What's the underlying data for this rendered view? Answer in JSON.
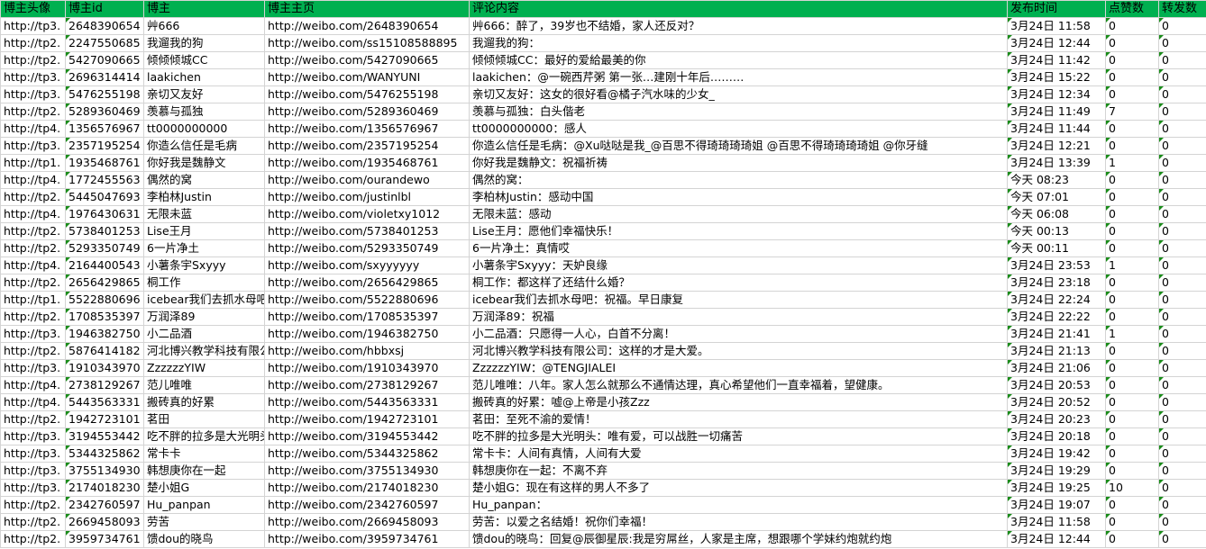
{
  "header": [
    "博主头像",
    "博主id",
    "博主",
    "博主主页",
    "评论内容",
    "发布时间",
    "点赞数",
    "转发数"
  ],
  "colors": {
    "header_bg": "#00b050",
    "grid": "#d4d4d4",
    "flag": "#1a8c1a"
  },
  "rows": [
    [
      "http://tp3.",
      "2648390654",
      "艸666",
      "http://weibo.com/2648390654",
      "艸666：醉了，39岁也不结婚，家人还反对？",
      "3月24日 11:58",
      "0",
      "0"
    ],
    [
      "http://tp2.",
      "2247550685",
      "我遛我的狗",
      "http://weibo.com/ss15108588895",
      "我遛我的狗：",
      "3月24日 12:44",
      "0",
      "0"
    ],
    [
      "http://tp2.",
      "5427090665",
      "倾倾倾城CC",
      "http://weibo.com/5427090665",
      "倾倾倾城CC：最好的爱給最美的你",
      "3月24日 11:42",
      "0",
      "0"
    ],
    [
      "http://tp3.",
      "2696314414",
      "laakichen",
      "http://weibo.com/WANYUNI",
      "laakichen：@一碗西芹粥 第一张…建刚十年后………",
      "3月24日 15:22",
      "0",
      "0"
    ],
    [
      "http://tp3.",
      "5476255198",
      "亲切又友好",
      "http://weibo.com/5476255198",
      "亲切又友好：这女的很好看@橘子汽水味的少女_",
      "3月24日 12:34",
      "0",
      "0"
    ],
    [
      "http://tp2.",
      "5289360469",
      "羡慕与孤独",
      "http://weibo.com/5289360469",
      "羡慕与孤独：白头偕老",
      "3月24日 11:49",
      "7",
      "0"
    ],
    [
      "http://tp4.",
      "1356576967",
      "tt0000000000",
      "http://weibo.com/1356576967",
      "tt0000000000：感人",
      "3月24日 11:44",
      "0",
      "0"
    ],
    [
      "http://tp3.",
      "2357195254",
      "你造么信任是毛病",
      "http://weibo.com/2357195254",
      "你造么信任是毛病：@Xu哒哒是我_@百思不得琦琦琦琦姐 @百思不得琦琦琦琦姐 @你牙缝",
      "3月24日 12:21",
      "0",
      "0"
    ],
    [
      "http://tp1.",
      "1935468761",
      "你好我是魏静文",
      "http://weibo.com/1935468761",
      "你好我是魏静文：祝福祈祷",
      "3月24日 13:39",
      "1",
      "0"
    ],
    [
      "http://tp4.",
      "1772455563",
      "偶然的窝",
      "http://weibo.com/ourandewo",
      "偶然的窝：",
      "今天 08:23",
      "0",
      "0"
    ],
    [
      "http://tp2.",
      "5445047693",
      "李柏林Justin",
      "http://weibo.com/justinlbl",
      "李柏林Justin：感动中国",
      "今天 07:01",
      "0",
      "0"
    ],
    [
      "http://tp4.",
      "1976430631",
      "无限未蓝",
      "http://weibo.com/violetxy1012",
      "无限未蓝：感动",
      "今天 06:08",
      "0",
      "0"
    ],
    [
      "http://tp2.",
      "5738401253",
      "Lise王月",
      "http://weibo.com/5738401253",
      "Lise王月：愿他们幸福快乐！",
      "今天 00:13",
      "0",
      "0"
    ],
    [
      "http://tp2.",
      "5293350749",
      "6一片净土",
      "http://weibo.com/5293350749",
      "6一片净土：真情哎",
      "今天 00:11",
      "0",
      "0"
    ],
    [
      "http://tp4.",
      "2164400543",
      "小薯条宇Sxyyy",
      "http://weibo.com/sxyyyyyy",
      "小薯条宇Sxyyy：天妒良缘",
      "3月24日 23:53",
      "1",
      "0"
    ],
    [
      "http://tp2.",
      "2656429865",
      "桐工作",
      "http://weibo.com/2656429865",
      "桐工作：都这样了还结什么婚？",
      "3月24日 23:18",
      "0",
      "0"
    ],
    [
      "http://tp1.",
      "5522880696",
      "icebear我们去抓水母吧",
      "http://weibo.com/5522880696",
      "icebear我们去抓水母吧：祝福。早日康复",
      "3月24日 22:24",
      "0",
      "0"
    ],
    [
      "http://tp2.",
      "1708535397",
      "万润泽89",
      "http://weibo.com/1708535397",
      "万润泽89：祝福",
      "3月24日 22:22",
      "0",
      "0"
    ],
    [
      "http://tp3.",
      "1946382750",
      "小二品酒",
      "http://weibo.com/1946382750",
      "小二品酒：只愿得一人心，白首不分离！",
      "3月24日 21:41",
      "1",
      "0"
    ],
    [
      "http://tp2.",
      "5876414182",
      "河北博兴教学科技有限公司",
      "http://weibo.com/hbbxsj",
      "河北博兴教学科技有限公司：这样的才是大爱。",
      "3月24日 21:13",
      "0",
      "0"
    ],
    [
      "http://tp3.",
      "1910343970",
      "ZzzzzzYIW",
      "http://weibo.com/1910343970",
      "ZzzzzzYIW：@TENGJIALEI",
      "3月24日 21:06",
      "0",
      "0"
    ],
    [
      "http://tp4.",
      "2738129267",
      "范儿唯唯",
      "http://weibo.com/2738129267",
      "范儿唯唯：八年。家人怎么就那么不通情达理，真心希望他们一直幸福着，望健康。",
      "3月24日 20:53",
      "0",
      "0"
    ],
    [
      "http://tp4.",
      "5443563331",
      "搬砖真的好累",
      "http://weibo.com/5443563331",
      "搬砖真的好累：嘘@上帝是小孩Zzz",
      "3月24日 20:52",
      "0",
      "0"
    ],
    [
      "http://tp2.",
      "1942723101",
      "茗田",
      "http://weibo.com/1942723101",
      "茗田：至死不渝的爱情！",
      "3月24日 20:23",
      "0",
      "0"
    ],
    [
      "http://tp3.",
      "3194553442",
      "吃不胖的拉多是大光明头",
      "http://weibo.com/3194553442",
      "吃不胖的拉多是大光明头：唯有爱，可以战胜一切痛苦",
      "3月24日 20:18",
      "0",
      "0"
    ],
    [
      "http://tp3.",
      "5344325862",
      "常卡卡",
      "http://weibo.com/5344325862",
      "常卡卡：人间有真情，人间有大爱",
      "3月24日 19:42",
      "0",
      "0"
    ],
    [
      "http://tp3.",
      "3755134930",
      "韩想庚你在一起",
      "http://weibo.com/3755134930",
      "韩想庚你在一起：不离不弃",
      "3月24日 19:29",
      "0",
      "0"
    ],
    [
      "http://tp3.",
      "2174018230",
      "楚小姐G",
      "http://weibo.com/2174018230",
      "楚小姐G：现在有这样的男人不多了",
      "3月24日 19:25",
      "10",
      "0"
    ],
    [
      "http://tp2.",
      "2342760597",
      "Hu_panpan",
      "http://weibo.com/2342760597",
      "Hu_panpan：",
      "3月24日 19:07",
      "0",
      "0"
    ],
    [
      "http://tp2.",
      "2669458093",
      "劳苦",
      "http://weibo.com/2669458093",
      "劳苦：以爱之名结婚！祝你们幸福！",
      "3月24日 11:58",
      "0",
      "0"
    ],
    [
      "http://tp2.",
      "3959734761",
      "馈dou的晓鸟",
      "http://weibo.com/3959734761",
      "馈dou的晓鸟：回复@辰御星辰:我是穷屌丝，人家是主席，想跟哪个学妹约炮就约炮",
      "3月24日 12:44",
      "0",
      "0"
    ]
  ]
}
